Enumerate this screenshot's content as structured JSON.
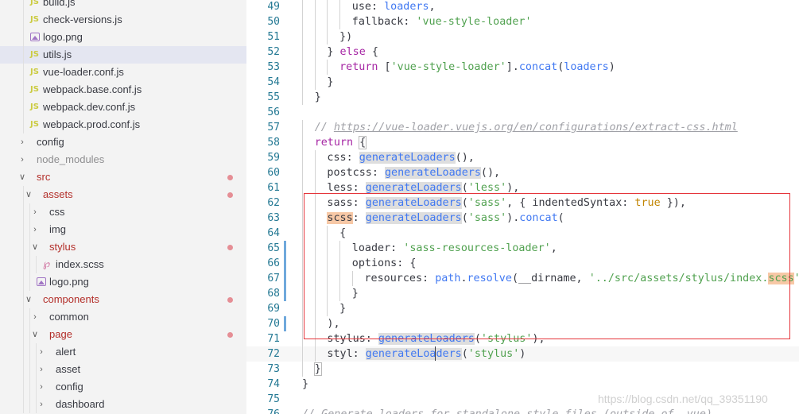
{
  "explorer": {
    "items": [
      {
        "label": "build.js",
        "type": "js",
        "depth": 2,
        "state": "normal"
      },
      {
        "label": "check-versions.js",
        "type": "js",
        "depth": 2,
        "state": "normal"
      },
      {
        "label": "logo.png",
        "type": "png",
        "depth": 2,
        "state": "normal"
      },
      {
        "label": "utils.js",
        "type": "js",
        "depth": 2,
        "state": "normal",
        "active": true
      },
      {
        "label": "vue-loader.conf.js",
        "type": "js",
        "depth": 2,
        "state": "normal"
      },
      {
        "label": "webpack.base.conf.js",
        "type": "js",
        "depth": 2,
        "state": "normal"
      },
      {
        "label": "webpack.dev.conf.js",
        "type": "js",
        "depth": 2,
        "state": "normal"
      },
      {
        "label": "webpack.prod.conf.js",
        "type": "js",
        "depth": 2,
        "state": "normal"
      },
      {
        "label": "config",
        "type": "folder",
        "depth": 1,
        "expanded": false,
        "state": "normal"
      },
      {
        "label": "node_modules",
        "type": "folder",
        "depth": 1,
        "expanded": false,
        "state": "ignored"
      },
      {
        "label": "src",
        "type": "folder",
        "depth": 1,
        "expanded": true,
        "state": "modified",
        "dot": true
      },
      {
        "label": "assets",
        "type": "folder",
        "depth": 2,
        "expanded": true,
        "state": "modified",
        "dot": true
      },
      {
        "label": "css",
        "type": "folder",
        "depth": 3,
        "expanded": false,
        "state": "normal"
      },
      {
        "label": "img",
        "type": "folder",
        "depth": 3,
        "expanded": false,
        "state": "normal"
      },
      {
        "label": "stylus",
        "type": "folder",
        "depth": 3,
        "expanded": true,
        "state": "modified",
        "dot": true
      },
      {
        "label": "index.scss",
        "type": "scss",
        "depth": 4,
        "state": "normal"
      },
      {
        "label": "logo.png",
        "type": "png",
        "depth": 3,
        "state": "normal"
      },
      {
        "label": "components",
        "type": "folder",
        "depth": 2,
        "expanded": true,
        "state": "modified",
        "dot": true
      },
      {
        "label": "common",
        "type": "folder",
        "depth": 3,
        "expanded": false,
        "state": "normal"
      },
      {
        "label": "page",
        "type": "folder",
        "depth": 3,
        "expanded": true,
        "state": "modified",
        "dot": true
      },
      {
        "label": "alert",
        "type": "folder",
        "depth": 4,
        "expanded": false,
        "state": "normal"
      },
      {
        "label": "asset",
        "type": "folder",
        "depth": 4,
        "expanded": false,
        "state": "normal"
      },
      {
        "label": "config",
        "type": "folder",
        "depth": 4,
        "expanded": false,
        "state": "normal"
      },
      {
        "label": "dashboard",
        "type": "folder",
        "depth": 4,
        "expanded": false,
        "state": "normal"
      }
    ]
  },
  "editor": {
    "lines": [
      {
        "n": "49",
        "indent": 4,
        "tokens": [
          [
            "p",
            "use: "
          ],
          [
            "fn",
            "loaders"
          ],
          [
            "p",
            ","
          ]
        ]
      },
      {
        "n": "50",
        "indent": 4,
        "tokens": [
          [
            "p",
            "fallback: "
          ],
          [
            "str",
            "'vue-style-loader'"
          ]
        ]
      },
      {
        "n": "51",
        "indent": 3,
        "tokens": [
          [
            "p",
            "})"
          ]
        ]
      },
      {
        "n": "52",
        "indent": 2,
        "tokens": [
          [
            "p",
            "} "
          ],
          [
            "kw",
            "else"
          ],
          [
            "p",
            " {"
          ]
        ]
      },
      {
        "n": "53",
        "indent": 3,
        "tokens": [
          [
            "kw",
            "return"
          ],
          [
            "p",
            " ["
          ],
          [
            "str",
            "'vue-style-loader'"
          ],
          [
            "p",
            "]."
          ],
          [
            "fn",
            "concat"
          ],
          [
            "p",
            "("
          ],
          [
            "fn",
            "loaders"
          ],
          [
            "p",
            ")"
          ]
        ]
      },
      {
        "n": "54",
        "indent": 2,
        "tokens": [
          [
            "p",
            "}"
          ]
        ]
      },
      {
        "n": "55",
        "indent": 1,
        "tokens": [
          [
            "p",
            "}"
          ]
        ]
      },
      {
        "n": "56",
        "indent": 0,
        "tokens": []
      },
      {
        "n": "57",
        "indent": 1,
        "tokens": [
          [
            "cm",
            "// "
          ],
          [
            "url",
            "https://vue-loader.vuejs.org/en/configurations/extract-css.html"
          ]
        ]
      },
      {
        "n": "58",
        "indent": 1,
        "tokens": [
          [
            "kw",
            "return"
          ],
          [
            "p",
            " "
          ],
          [
            "p!bm",
            "{"
          ]
        ]
      },
      {
        "n": "59",
        "indent": 2,
        "tokens": [
          [
            "p",
            "css: "
          ],
          [
            "fn!hl",
            "generateLoaders"
          ],
          [
            "p",
            "(),"
          ]
        ]
      },
      {
        "n": "60",
        "indent": 2,
        "tokens": [
          [
            "p",
            "postcss: "
          ],
          [
            "fn!hl",
            "generateLoaders"
          ],
          [
            "p",
            "(),"
          ]
        ]
      },
      {
        "n": "61",
        "indent": 2,
        "tokens": [
          [
            "p",
            "less: "
          ],
          [
            "fn!hl",
            "generateLoaders"
          ],
          [
            "p",
            "("
          ],
          [
            "str",
            "'less'"
          ],
          [
            "p",
            "),"
          ]
        ]
      },
      {
        "n": "62",
        "indent": 2,
        "tokens": [
          [
            "p",
            "sass: "
          ],
          [
            "fn!hl",
            "generateLoaders"
          ],
          [
            "p",
            "("
          ],
          [
            "str",
            "'sass'"
          ],
          [
            "p",
            ", { indentedSyntax: "
          ],
          [
            "bool",
            "true"
          ],
          [
            "p",
            " }),"
          ]
        ]
      },
      {
        "n": "63",
        "indent": 2,
        "tokens": [
          [
            "p!hlo",
            "scss"
          ],
          [
            "p",
            ": "
          ],
          [
            "fn!hl",
            "generateLoaders"
          ],
          [
            "p",
            "("
          ],
          [
            "str",
            "'sass'"
          ],
          [
            "p",
            ")."
          ],
          [
            "fn",
            "concat"
          ],
          [
            "p",
            "("
          ]
        ]
      },
      {
        "n": "64",
        "indent": 3,
        "tokens": [
          [
            "p",
            "{"
          ]
        ]
      },
      {
        "n": "65",
        "indent": 4,
        "tokens": [
          [
            "p",
            "loader: "
          ],
          [
            "str",
            "'sass-resources-loader'"
          ],
          [
            "p",
            ","
          ]
        ],
        "gutter": true
      },
      {
        "n": "66",
        "indent": 4,
        "tokens": [
          [
            "p",
            "options: {"
          ]
        ],
        "gutter": true
      },
      {
        "n": "67",
        "indent": 5,
        "tokens": [
          [
            "p",
            "resources: "
          ],
          [
            "fn",
            "path"
          ],
          [
            "p",
            "."
          ],
          [
            "fn",
            "resolve"
          ],
          [
            "p",
            "(__dirname, "
          ],
          [
            "str",
            "'../src/assets/stylus/index."
          ],
          [
            "str!hlo",
            "scss"
          ],
          [
            "str",
            "'"
          ],
          [
            "p",
            ")"
          ]
        ],
        "gutter": true
      },
      {
        "n": "68",
        "indent": 4,
        "tokens": [
          [
            "p",
            "}"
          ]
        ],
        "gutter": true
      },
      {
        "n": "69",
        "indent": 3,
        "tokens": [
          [
            "p",
            "}"
          ]
        ]
      },
      {
        "n": "70",
        "indent": 2,
        "tokens": [
          [
            "p",
            "),"
          ]
        ],
        "gutter": true
      },
      {
        "n": "71",
        "indent": 2,
        "tokens": [
          [
            "p",
            "stylus: "
          ],
          [
            "fn!hl",
            "generateLoaders"
          ],
          [
            "p",
            "("
          ],
          [
            "str",
            "'stylus'"
          ],
          [
            "p",
            "),"
          ]
        ]
      },
      {
        "n": "72",
        "indent": 2,
        "tokens": [
          [
            "p",
            "styl: "
          ],
          [
            "fn!hl",
            "generateLoaders"
          ],
          [
            "p",
            "("
          ],
          [
            "str",
            "'stylus'"
          ],
          [
            "p",
            ")"
          ]
        ],
        "current": true
      },
      {
        "n": "73",
        "indent": 1,
        "tokens": [
          [
            "p!bm",
            "}"
          ]
        ]
      },
      {
        "n": "74",
        "indent": 0,
        "tokens": [
          [
            "p",
            "}"
          ]
        ]
      },
      {
        "n": "75",
        "indent": 0,
        "tokens": []
      },
      {
        "n": "76",
        "indent": 0,
        "tokens": [
          [
            "cm",
            "// Generate loaders for standalone style files (outside of .vue)"
          ]
        ]
      }
    ]
  },
  "watermark": "https://blog.csdn.net/qq_39351190",
  "colors": {
    "sidebar_bg": "#f3f3f3",
    "active_row": "#e4e6f1",
    "modified": "#b32f2a",
    "highlight_box": "#e5353b"
  }
}
